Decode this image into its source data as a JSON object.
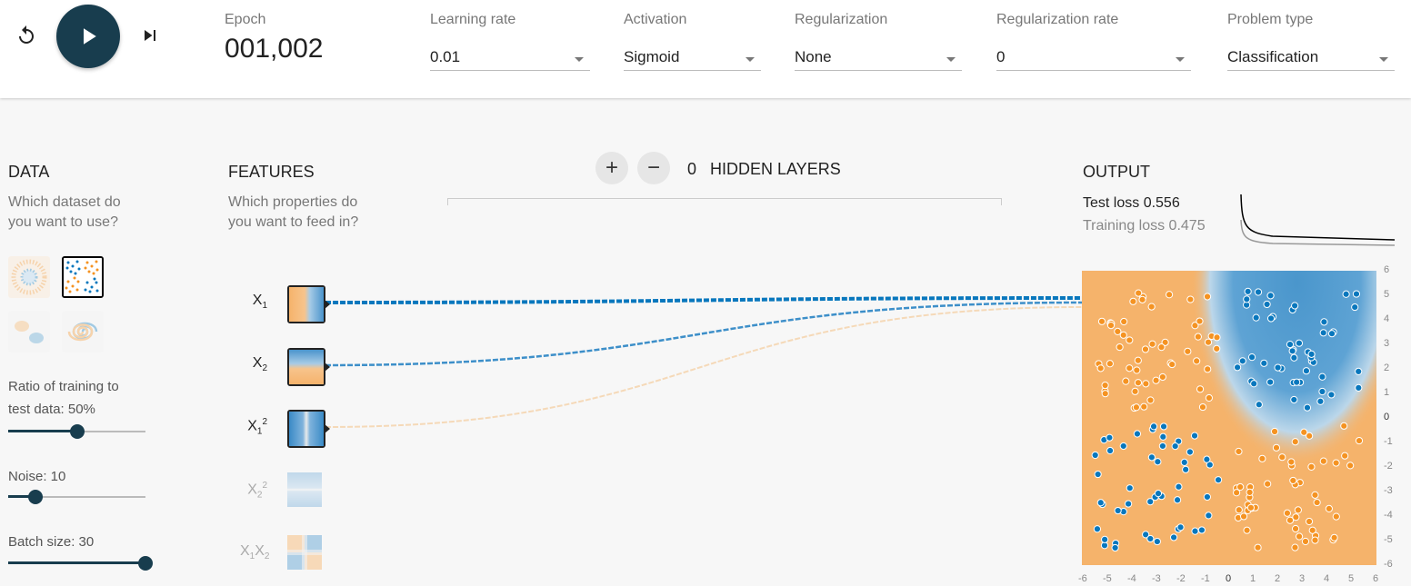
{
  "controls": {
    "epoch_label": "Epoch",
    "epoch_value": "001,002",
    "learning_rate": {
      "label": "Learning rate",
      "value": "0.01"
    },
    "activation": {
      "label": "Activation",
      "value": "Sigmoid"
    },
    "regularization": {
      "label": "Regularization",
      "value": "None"
    },
    "regularization_rate": {
      "label": "Regularization rate",
      "value": "0"
    },
    "problem_type": {
      "label": "Problem type",
      "value": "Classification"
    }
  },
  "data_panel": {
    "title": "DATA",
    "subtitle_line1": "Which dataset do",
    "subtitle_line2": "you want to use?",
    "datasets": [
      "circle",
      "xor",
      "gaussian",
      "spiral"
    ],
    "selected_dataset": "xor",
    "ratio_label_line1": "Ratio of training to",
    "ratio_label_line2": "test data:  50%",
    "ratio_value": 50,
    "noise_label": "Noise:  10",
    "noise_value": 10,
    "batch_label": "Batch size:  30",
    "batch_value": 30
  },
  "features_panel": {
    "title": "FEATURES",
    "subtitle_line1": "Which properties do",
    "subtitle_line2": "you want to feed in?",
    "features": [
      {
        "base": "X",
        "sub": "1",
        "sup": "",
        "active": true
      },
      {
        "base": "X",
        "sub": "2",
        "sup": "",
        "active": true
      },
      {
        "base": "X",
        "sub": "1",
        "sup": "2",
        "active": true
      },
      {
        "base": "X",
        "sub": "2",
        "sup": "2",
        "active": false
      },
      {
        "base": "X",
        "sub": "1",
        "sup": "",
        "base2": "X",
        "sub2": "2",
        "active": false
      }
    ]
  },
  "network": {
    "hidden_layers_count": "0",
    "hidden_layers_label": "HIDDEN LAYERS",
    "add_symbol": "+",
    "remove_symbol": "−"
  },
  "output_panel": {
    "title": "OUTPUT",
    "test_loss_label": "Test loss 0.556",
    "training_loss_label": "Training loss 0.475",
    "test_loss": 0.556,
    "training_loss": 0.475,
    "axis_ticks": [
      "-6",
      "-5",
      "-4",
      "-3",
      "-2",
      "-1",
      "0",
      "1",
      "2",
      "3",
      "4",
      "5",
      "6"
    ],
    "colors": {
      "positive": "#0877bd",
      "negative": "#f59322",
      "neutral": "#e8eaeb"
    }
  }
}
